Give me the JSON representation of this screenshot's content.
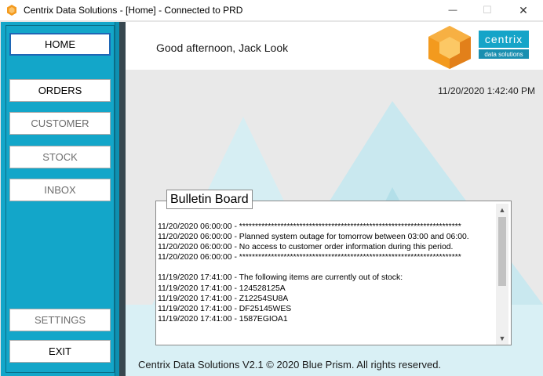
{
  "window": {
    "title": "Centrix Data Solutions - [Home] - Connected to PRD",
    "minimize_glyph": "—",
    "maximize_glyph": "☐",
    "close_glyph": "✕"
  },
  "nav": {
    "home": "HOME",
    "orders": "ORDERS",
    "customer": "CUSTOMER",
    "stock": "STOCK",
    "inbox": "INBOX",
    "settings": "SETTINGS",
    "exit": "EXIT"
  },
  "header": {
    "greeting": "Good afternoon, Jack Look",
    "logo_word": "centrix",
    "logo_sub": "data solutions"
  },
  "timestamp": "11/20/2020 1:42:40 PM",
  "bulletin": {
    "title": "Bulletin Board",
    "lines": [
      "11/20/2020 06:00:00 - **********************************************************************",
      "11/20/2020 06:00:00 - Planned system outage for tomorrow between 03:00 and 06:00.",
      "11/20/2020 06:00:00 - No access to customer order information during this period.",
      "11/20/2020 06:00:00 - **********************************************************************",
      "",
      "11/19/2020 17:41:00 - The following items are currently out of stock:",
      "11/19/2020 17:41:00 - 124528125A",
      "11/19/2020 17:41:00 - Z12254SU8A",
      "11/19/2020 17:41:00 - DF25145WES",
      "11/19/2020 17:41:00 - 1587EGIOA1"
    ]
  },
  "footer": "Centrix Data Solutions V2.1 © 2020 Blue Prism. All rights reserved.",
  "colors": {
    "sidebar": "#13a6c9",
    "accent_orange": "#f39a1e",
    "logo_blue": "#15a4c8"
  }
}
